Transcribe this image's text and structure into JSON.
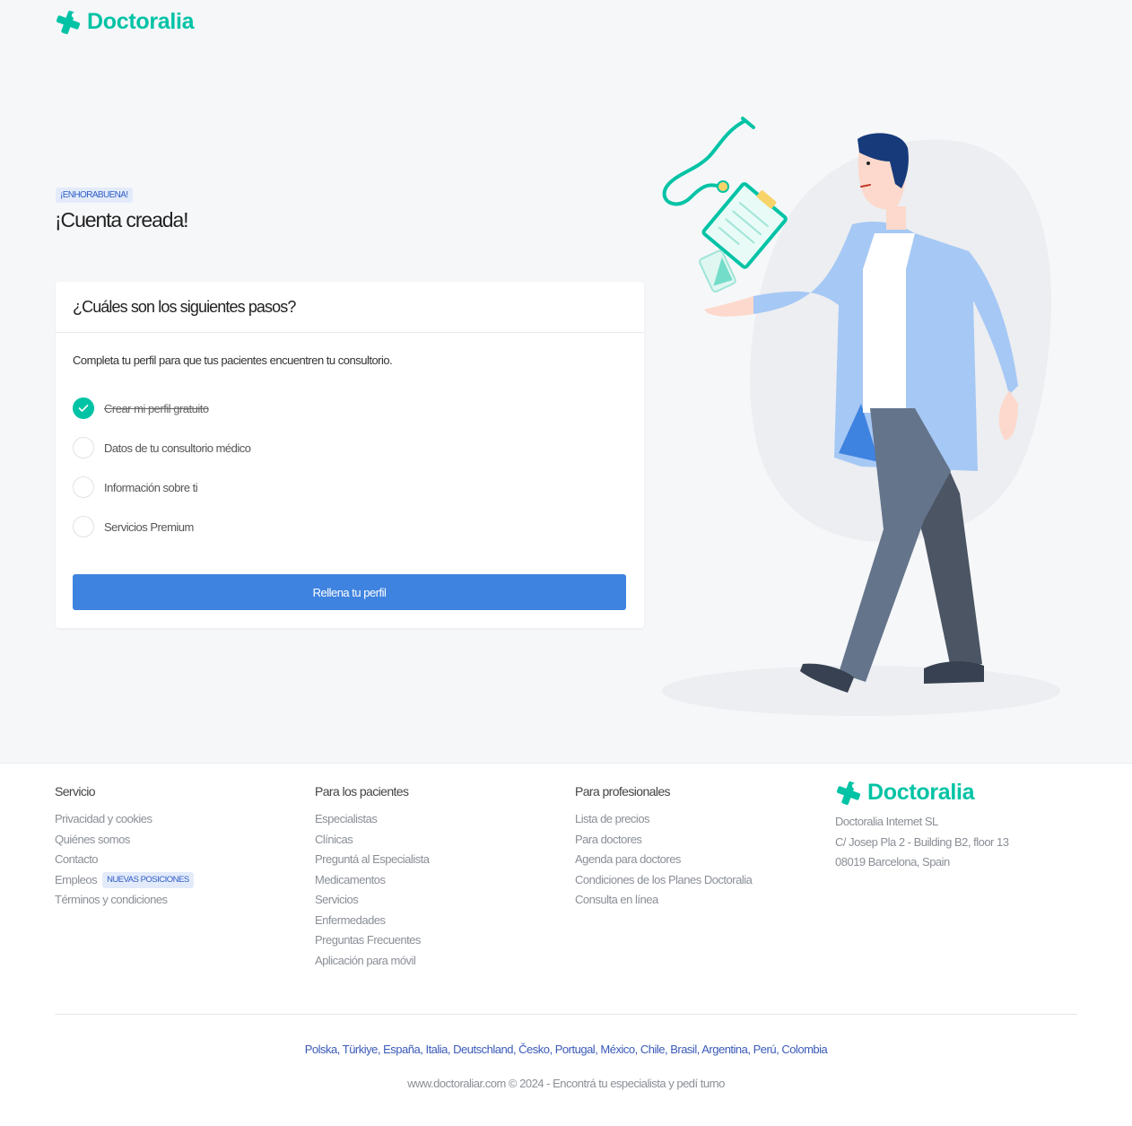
{
  "brand": {
    "name": "Doctoralia",
    "color": "#00c3a5"
  },
  "hero": {
    "badge": "¡ENHORABUENA!",
    "title": "¡Cuenta creada!"
  },
  "card": {
    "title": "¿Cuáles son los siguientes pasos?",
    "intro": "Completa tu perfil para que tus pacientes encuentren tu consultorio.",
    "steps": [
      {
        "label": "Crear mi perfil gratuito",
        "done": true
      },
      {
        "label": "Datos de tu consultorio médico",
        "done": false
      },
      {
        "label": "Información sobre ti",
        "done": false
      },
      {
        "label": "Servicios Premium",
        "done": false
      }
    ],
    "button_label": "Rellena tu perfil",
    "button_color": "#3f83e0"
  },
  "illustration": {
    "icon": "doctor-illustration"
  },
  "footer": {
    "columns": [
      {
        "title": "Servicio",
        "links": [
          "Privacidad y cookies",
          "Quiénes somos",
          "Contacto",
          "Empleos",
          "Términos y condiciones"
        ],
        "jobs_badge": "NUEVAS POSICIONES"
      },
      {
        "title": "Para los pacientes",
        "links": [
          "Especialistas",
          "Clínicas",
          "Preguntá al Especialista",
          "Medicamentos",
          "Servicios",
          "Enfermedades",
          "Preguntas Frecuentes",
          "Aplicación para móvil"
        ]
      },
      {
        "title": "Para profesionales",
        "links": [
          "Lista de precios",
          "Para doctores",
          "Agenda para doctores",
          "Condiciones de los Planes Doctoralia",
          "Consulta en línea"
        ]
      }
    ],
    "company": {
      "name": "Doctoralia Internet SL",
      "street": "C/ Josep Pla 2 - Building B2, floor 13",
      "city": "08019 Barcelona, Spain"
    },
    "countries": [
      "Polska",
      "Türkiye",
      "España",
      "Italia",
      "Deutschland",
      "Česko",
      "Portugal",
      "México",
      "Chile",
      "Brasil",
      "Argentina",
      "Perú",
      "Colombia"
    ],
    "copyright": "www.doctoraliar.com © 2024 - Encontrá tu especialista y pedí turno"
  }
}
